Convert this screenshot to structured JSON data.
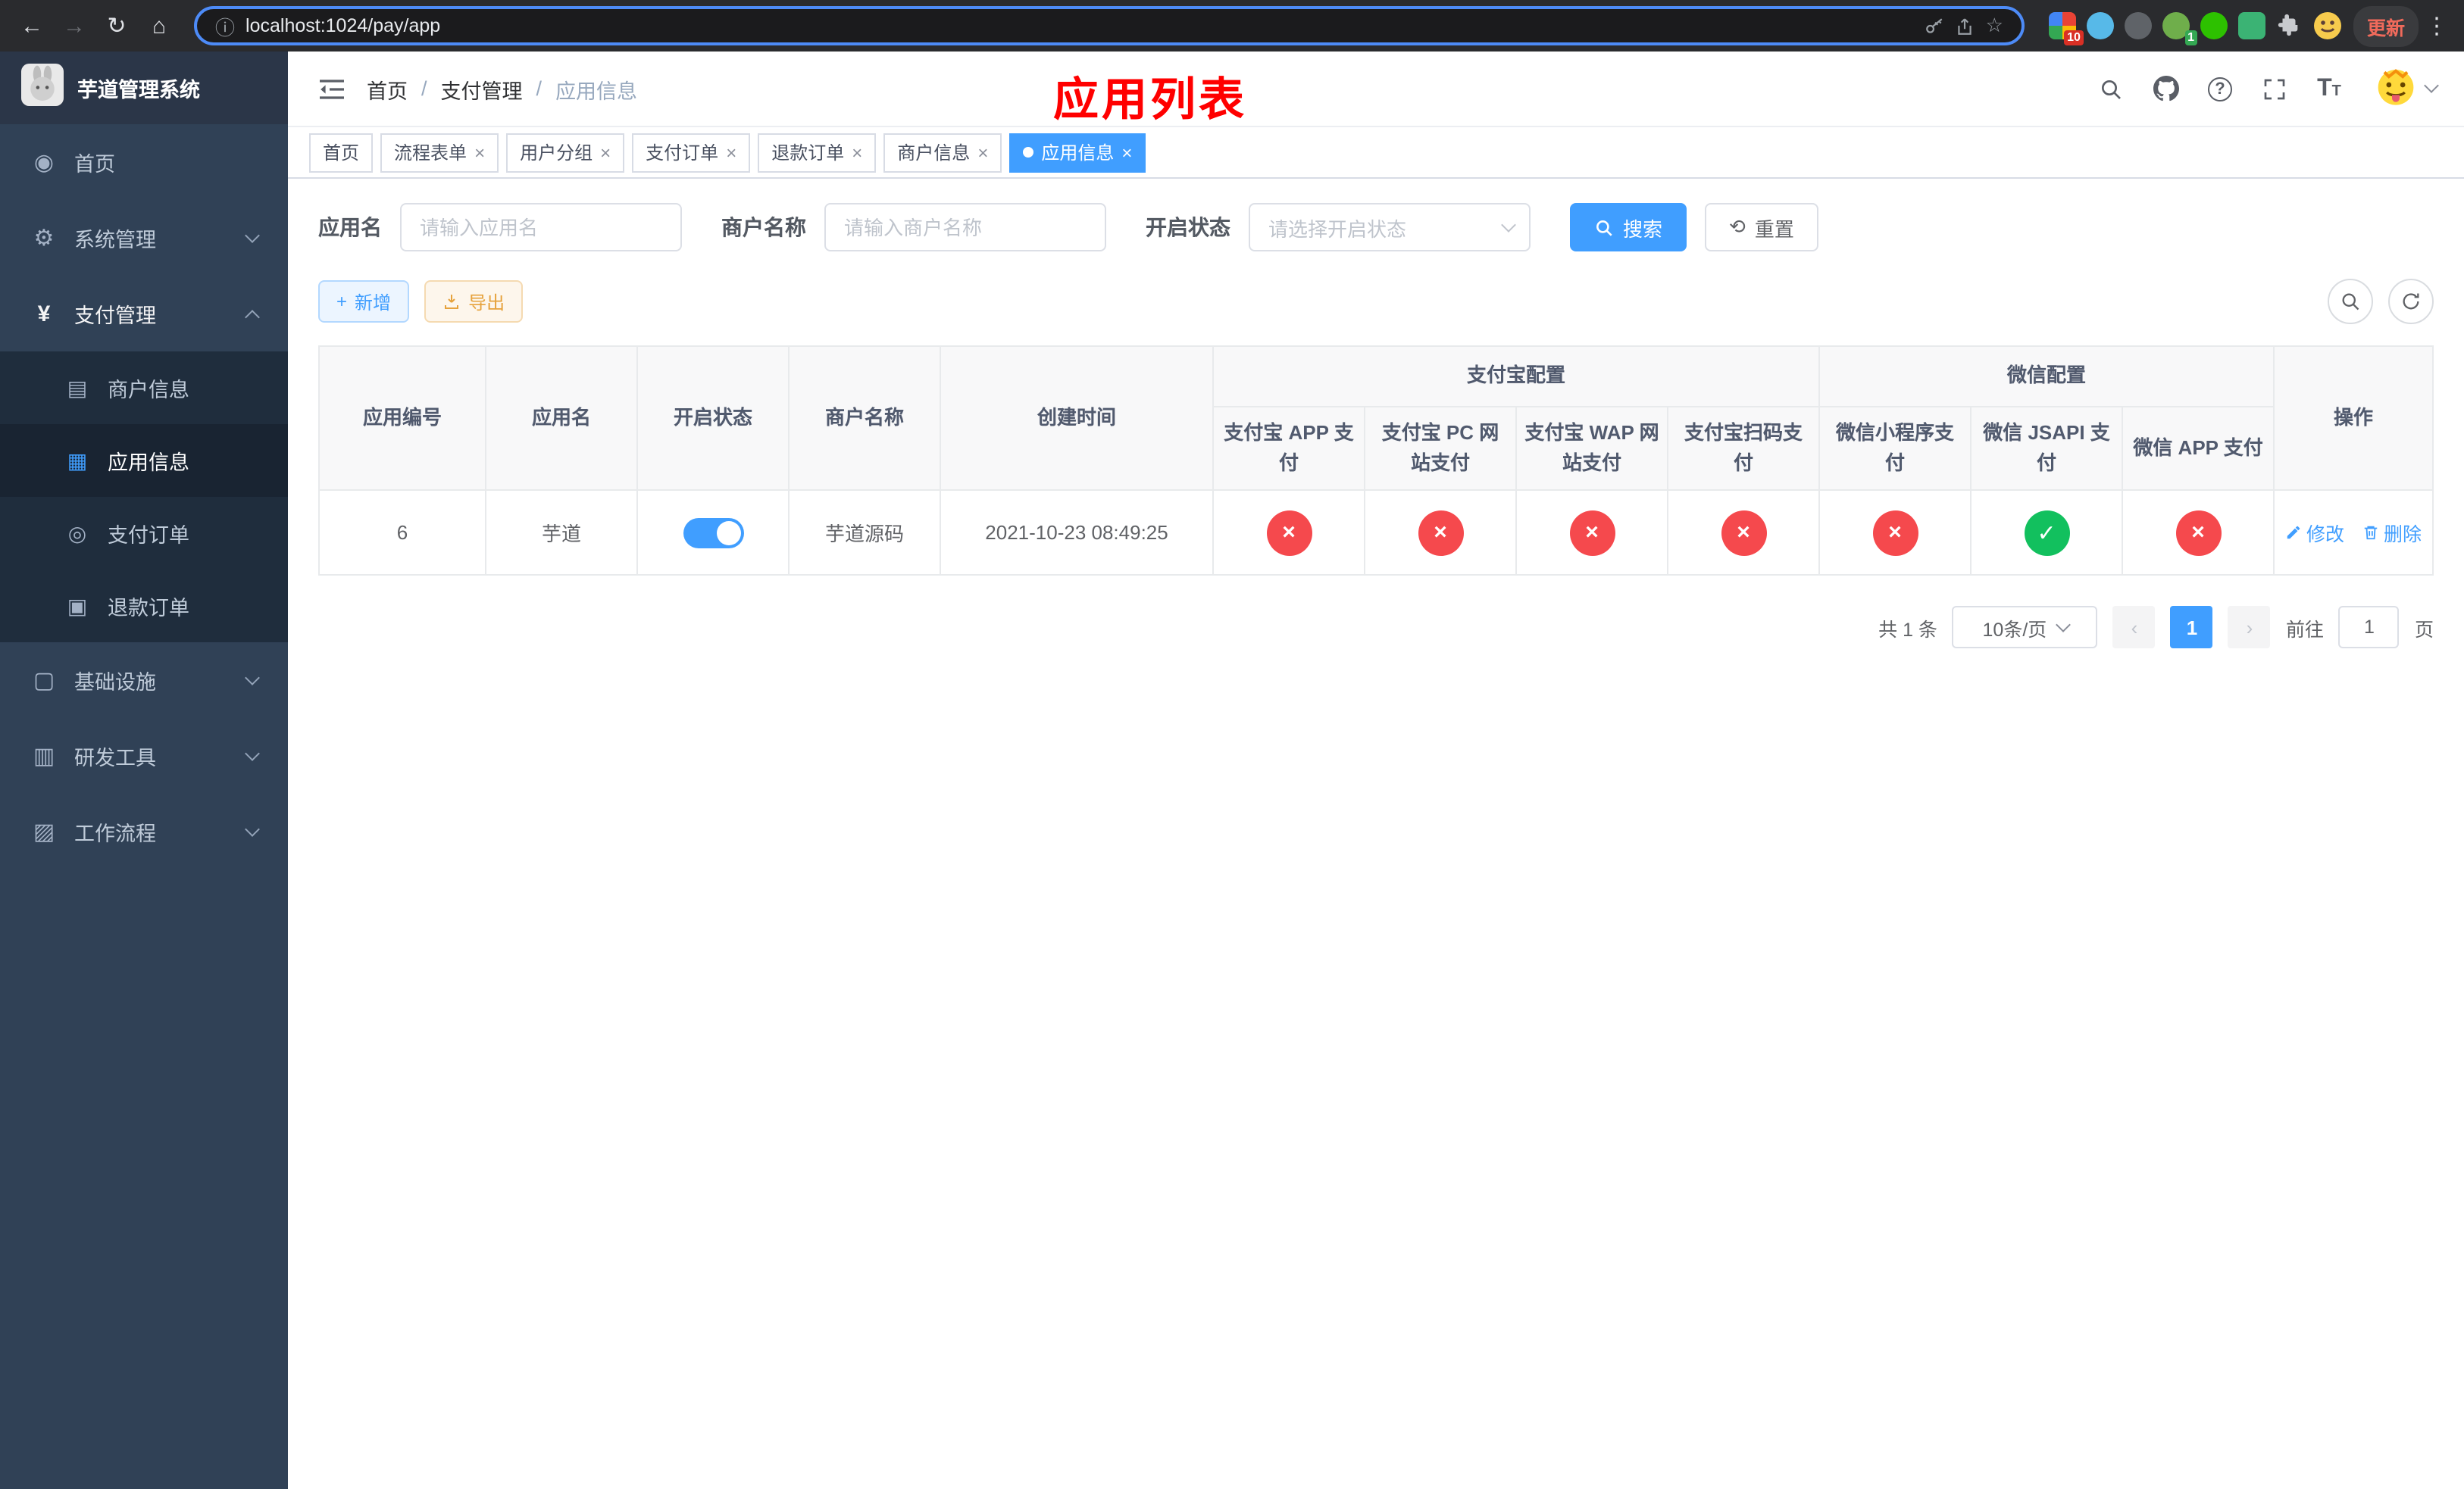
{
  "colors": {
    "primary": "#409eff",
    "danger": "#f5494d",
    "success": "#12c05e",
    "warning": "#e6a23c",
    "sidebar_bg": "#304156",
    "submenu_bg": "#1f2d3d",
    "annotation_red": "#ff0000"
  },
  "browser": {
    "url": "localhost:1024/pay/app",
    "ext_badge_1": "10",
    "ext_badge_2": "1",
    "update_label": "更新"
  },
  "sidebar": {
    "title": "芋道管理系统",
    "items": [
      {
        "label": "首页"
      },
      {
        "label": "系统管理"
      },
      {
        "label": "支付管理",
        "children": [
          {
            "label": "商户信息"
          },
          {
            "label": "应用信息"
          },
          {
            "label": "支付订单"
          },
          {
            "label": "退款订单"
          }
        ]
      },
      {
        "label": "基础设施"
      },
      {
        "label": "研发工具"
      },
      {
        "label": "工作流程"
      }
    ]
  },
  "navbar": {
    "breadcrumb": [
      "首页",
      "支付管理",
      "应用信息"
    ],
    "overlay_title": "应用列表"
  },
  "tabs": [
    {
      "label": "首页",
      "closable": false,
      "active": false
    },
    {
      "label": "流程表单",
      "closable": true,
      "active": false
    },
    {
      "label": "用户分组",
      "closable": true,
      "active": false
    },
    {
      "label": "支付订单",
      "closable": true,
      "active": false
    },
    {
      "label": "退款订单",
      "closable": true,
      "active": false
    },
    {
      "label": "商户信息",
      "closable": true,
      "active": false
    },
    {
      "label": "应用信息",
      "closable": true,
      "active": true
    }
  ],
  "filters": {
    "app_name_label": "应用名",
    "app_name_placeholder": "请输入应用名",
    "merchant_label": "商户名称",
    "merchant_placeholder": "请输入商户名称",
    "status_label": "开启状态",
    "status_placeholder": "请选择开启状态",
    "search_label": "搜索",
    "reset_label": "重置"
  },
  "toolbar": {
    "add_label": "新增",
    "export_label": "导出"
  },
  "table": {
    "main_columns": [
      "应用编号",
      "应用名",
      "开启状态",
      "商户名称",
      "创建时间"
    ],
    "alipay_group": {
      "label": "支付宝配置",
      "columns": [
        "支付宝 APP 支付",
        "支付宝 PC 网站支付",
        "支付宝 WAP 网站支付",
        "支付宝扫码支付"
      ]
    },
    "wechat_group": {
      "label": "微信配置",
      "columns": [
        "微信小程序支付",
        "微信 JSAPI 支付",
        "微信 APP 支付"
      ]
    },
    "actions_column": "操作",
    "rows": [
      {
        "id": "6",
        "name": "芋道",
        "enabled": true,
        "merchant": "芋道源码",
        "created": "2021-10-23 08:49:25",
        "alipay_app": false,
        "alipay_pc": false,
        "alipay_wap": false,
        "alipay_qr": false,
        "wechat_mini": false,
        "wechat_jsapi": true,
        "wechat_app": false,
        "edit_label": "修改",
        "delete_label": "删除"
      }
    ]
  },
  "pagination": {
    "total_label": "共 1 条",
    "page_size_label": "10条/页",
    "current_page": "1",
    "goto_label": "前往",
    "goto_value": "1",
    "page_unit": "页"
  }
}
